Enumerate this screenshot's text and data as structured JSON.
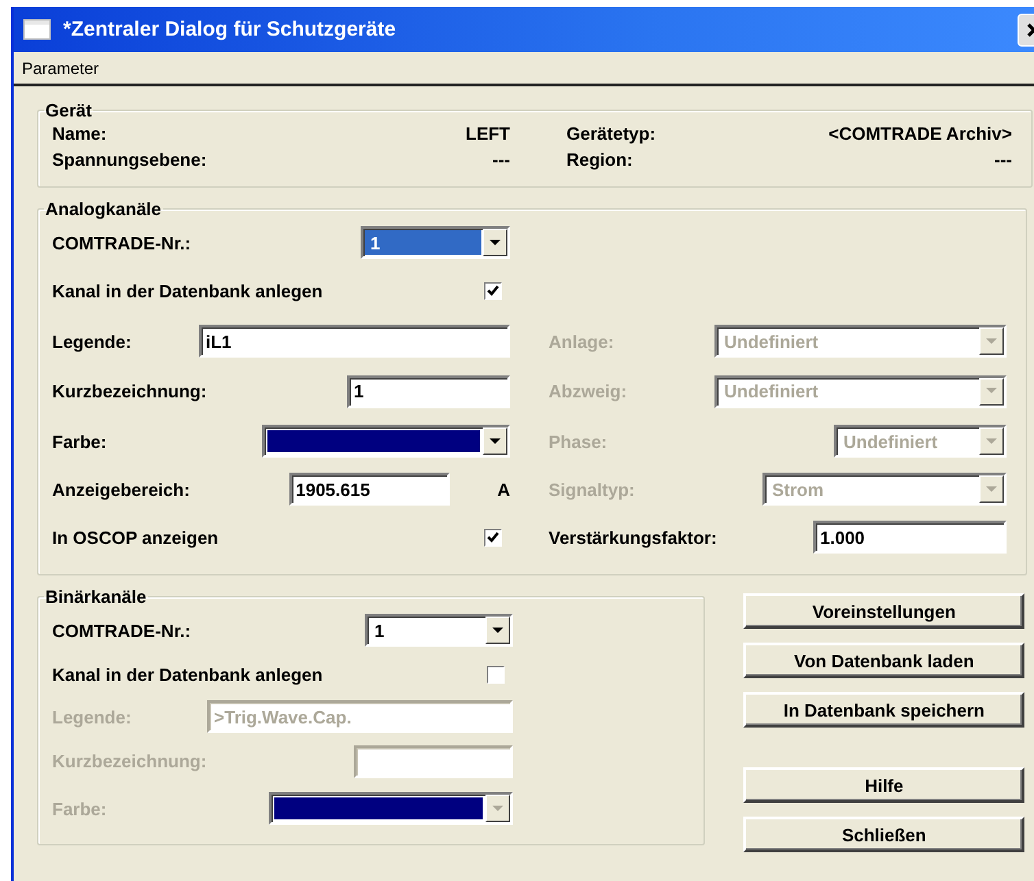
{
  "window": {
    "title": "*Zentraler Dialog für Schutzgeräte"
  },
  "menu": [
    "Parameter"
  ],
  "device": {
    "title": "Gerät",
    "fields": [
      {
        "label": "Name:",
        "value": "LEFT"
      },
      {
        "label": "Gerätetyp:",
        "value": "<COMTRADE Archiv>"
      },
      {
        "label": "Spannungsebene:",
        "value": "---"
      },
      {
        "label": "Region:",
        "value": "---"
      }
    ]
  },
  "analog": {
    "title": "Analogkanäle",
    "left": [
      {
        "kind": "combo",
        "label": "COMTRADE-Nr.:",
        "value": "1",
        "selected": true,
        "disabled": false
      },
      {
        "kind": "checkbox",
        "label": "Kanal in der Datenbank anlegen",
        "checked": true,
        "disabled": false
      },
      {
        "kind": "input",
        "label": "Legende:",
        "value": "iL1",
        "disabled": false
      },
      {
        "kind": "input",
        "label": "Kurzbezeichnung:",
        "value": "1",
        "disabled": false
      },
      {
        "kind": "color",
        "label": "Farbe:",
        "color": "#000080",
        "disabled": false
      },
      {
        "kind": "input",
        "label": "Anzeigebereich:",
        "value": "1905.615",
        "unit": "A",
        "disabled": false
      },
      {
        "kind": "checkbox",
        "label": "In OSCOP anzeigen",
        "checked": true,
        "disabled": false
      }
    ],
    "right": [
      {
        "kind": "combo",
        "label": "Anlage:",
        "value": "Undefiniert",
        "selected": false,
        "disabled": true
      },
      {
        "kind": "combo",
        "label": "Abzweig:",
        "value": "Undefiniert",
        "selected": false,
        "disabled": true
      },
      {
        "kind": "combo",
        "label": "Phase:",
        "value": "Undefiniert",
        "selected": false,
        "disabled": true
      },
      {
        "kind": "combo",
        "label": "Signaltyp:",
        "value": "Strom",
        "selected": false,
        "disabled": true
      },
      {
        "kind": "input",
        "label": "Verstärkungsfaktor:",
        "value": "1.000",
        "disabled": false
      }
    ]
  },
  "binary": {
    "title": "Binärkanäle",
    "rows": [
      {
        "kind": "combo",
        "label": "COMTRADE-Nr.:",
        "value": "1",
        "selected": false,
        "disabled": false
      },
      {
        "kind": "checkbox",
        "label": "Kanal in der Datenbank anlegen",
        "checked": false,
        "disabled": false
      },
      {
        "kind": "input",
        "label": "Legende:",
        "value": ">Trig.Wave.Cap.",
        "disabled": true
      },
      {
        "kind": "input",
        "label": "Kurzbezeichnung:",
        "disabled": true
      },
      {
        "kind": "color",
        "label": "Farbe:",
        "color": "#000080",
        "disabled": true
      }
    ]
  },
  "buttons": [
    "Voreinstellungen",
    "Von Datenbank laden",
    "In Datenbank speichern",
    "Hilfe",
    "Schließen"
  ]
}
